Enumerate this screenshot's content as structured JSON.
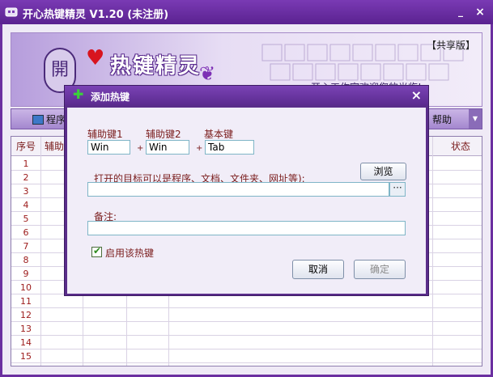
{
  "window": {
    "title": "开心热键精灵  V1.20 (未注册)",
    "min_label": "_",
    "close_label": "×"
  },
  "banner": {
    "edition": "【共享版】",
    "logo_char": "開",
    "logo_text": "热键精灵",
    "slogan": "开心工作室欢迎您的光临!"
  },
  "toolbar": {
    "left_label": "程序",
    "right_label": "帮助"
  },
  "grid": {
    "columns": [
      "序号",
      "辅助",
      "状态"
    ],
    "rows": [
      "1",
      "2",
      "3",
      "4",
      "5",
      "6",
      "7",
      "8",
      "9",
      "10",
      "11",
      "12",
      "13",
      "14",
      "15"
    ]
  },
  "dialog": {
    "title": "添加热键",
    "close_label": "×",
    "mod1_label": "辅助键1",
    "mod1_value": "Win",
    "mod2_label": "辅助键2",
    "mod2_value": "Win",
    "key_label": "基本键",
    "key_value": "Tab",
    "plus_sign": "+",
    "target_label": "打开的目标可以是程序、文档、文件夹、网址等):",
    "target_value": "",
    "browse_label": "浏览",
    "ellipsis_label": "···",
    "note_label": "备注:",
    "note_value": "",
    "enable_label": "启用该热键",
    "enable_checked": true,
    "cancel_label": "取消",
    "ok_label": "确定"
  }
}
